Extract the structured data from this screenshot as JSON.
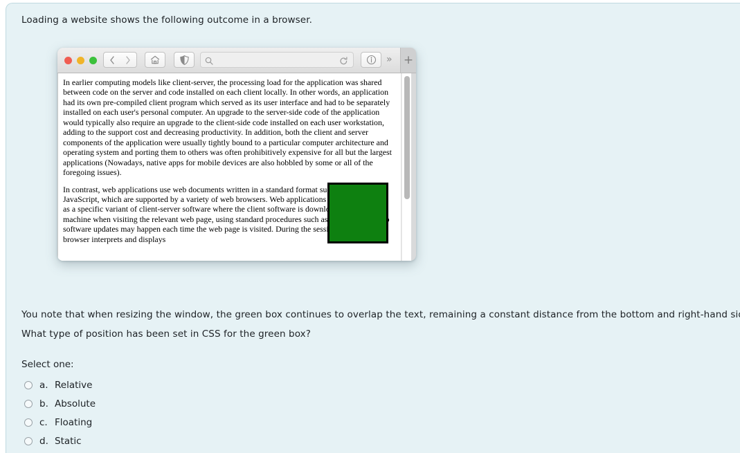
{
  "intro": "Loading a website shows the following outcome in a browser.",
  "browser": {
    "window_controls": [
      "close",
      "minimize",
      "maximize"
    ],
    "toolbar_icons": [
      "back-chevron-icon",
      "forward-chevron-icon",
      "home-icon",
      "shield-privacy-icon",
      "search-icon",
      "reload-icon",
      "info-icon",
      "overflow-chevrons-icon",
      "new-tab-plus-icon"
    ],
    "address_value": "",
    "address_placeholder": "",
    "overflow_glyph": "»",
    "newtab_glyph": "+",
    "page": {
      "paragraph_1": "In earlier computing models like client-server, the processing load for the application was shared between code on the server and code installed on each client locally. In other words, an application had its own pre-compiled client program which served as its user interface and had to be separately installed on each user's personal computer. An upgrade to the server-side code of the application would typically also require an upgrade to the client-side code installed on each user workstation, adding to the support cost and decreasing productivity. In addition, both the client and server components of the application were usually tightly bound to a particular computer architecture and operating system and porting them to others was often prohibitively expensive for all but the largest applications (Nowadays, native apps for mobile devices are also hobbled by some or all of the foregoing issues).",
      "paragraph_2": "In contrast, web applications use web documents written in a standard format such as HTML and JavaScript, which are supported by a variety of web browsers. Web applications can be considered as a specific variant of client-server software where the client software is downloaded to the client machine when visiting the relevant web page, using standard procedures such as HTTP. Client web software updates may happen each time the web page is visited. During the session, the web browser interprets and displays"
    },
    "green_box_color": "#0e8010",
    "green_box_border_color": "#000000"
  },
  "question": {
    "statement": "You note that when resizing the window, the green box continues to overlap the text, remaining a constant distance from the bottom and right-hand side.",
    "prompt": "What type of position has been set in CSS for the green box?",
    "select_label": "Select one:",
    "options": [
      {
        "letter": "a.",
        "label": "Relative",
        "selected": false
      },
      {
        "letter": "b.",
        "label": "Absolute",
        "selected": false
      },
      {
        "letter": "c.",
        "label": "Floating",
        "selected": false
      },
      {
        "letter": "d.",
        "label": "Static",
        "selected": false
      }
    ]
  },
  "colors": {
    "panel_background": "#e6f2f5",
    "text": "#1d2125",
    "accent_green": "#0e8010"
  }
}
